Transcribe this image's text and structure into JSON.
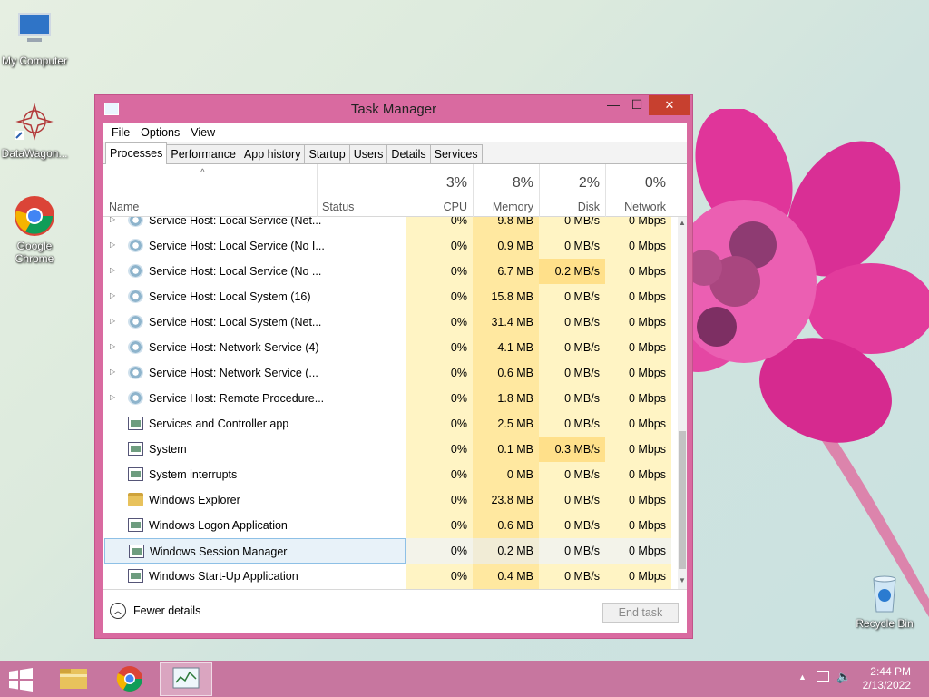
{
  "desktop": {
    "icons": [
      {
        "label": "My Computer",
        "icon": "computer-icon"
      },
      {
        "label": "DataWagon...",
        "icon": "datawagon-icon"
      },
      {
        "label": "Google Chrome",
        "icon": "chrome-icon"
      },
      {
        "label": "Recycle Bin",
        "icon": "recycle-bin-icon"
      }
    ]
  },
  "window": {
    "title": "Task Manager",
    "controls": {
      "minimize": "—",
      "maximize": "☐",
      "close": "✕"
    }
  },
  "menu": [
    "File",
    "Options",
    "View"
  ],
  "tabs": [
    {
      "label": "Processes",
      "active": true
    },
    {
      "label": "Performance"
    },
    {
      "label": "App history"
    },
    {
      "label": "Startup"
    },
    {
      "label": "Users"
    },
    {
      "label": "Details"
    },
    {
      "label": "Services"
    }
  ],
  "columns": {
    "name": "Name",
    "status": "Status",
    "cpu": {
      "pct": "3%",
      "label": "CPU"
    },
    "memory": {
      "pct": "8%",
      "label": "Memory"
    },
    "disk": {
      "pct": "2%",
      "label": "Disk"
    },
    "network": {
      "pct": "0%",
      "label": "Network"
    }
  },
  "rows": [
    {
      "name": "Service Host: Local Service (Net...",
      "icon": "gear-icon",
      "expandable": true,
      "cpu": "0%",
      "memory": "9.8 MB",
      "disk": "0 MB/s",
      "network": "0 Mbps"
    },
    {
      "name": "Service Host: Local Service (No I...",
      "icon": "gear-icon",
      "expandable": true,
      "cpu": "0%",
      "memory": "0.9 MB",
      "disk": "0 MB/s",
      "network": "0 Mbps"
    },
    {
      "name": "Service Host: Local Service (No ...",
      "icon": "gear-icon",
      "expandable": true,
      "cpu": "0%",
      "memory": "6.7 MB",
      "disk": "0.2 MB/s",
      "network": "0 Mbps"
    },
    {
      "name": "Service Host: Local System (16)",
      "icon": "gear-icon",
      "expandable": true,
      "cpu": "0%",
      "memory": "15.8 MB",
      "disk": "0 MB/s",
      "network": "0 Mbps"
    },
    {
      "name": "Service Host: Local System (Net...",
      "icon": "gear-icon",
      "expandable": true,
      "cpu": "0%",
      "memory": "31.4 MB",
      "disk": "0 MB/s",
      "network": "0 Mbps"
    },
    {
      "name": "Service Host: Network Service (4)",
      "icon": "gear-icon",
      "expandable": true,
      "cpu": "0%",
      "memory": "4.1 MB",
      "disk": "0 MB/s",
      "network": "0 Mbps"
    },
    {
      "name": "Service Host: Network Service (...",
      "icon": "gear-icon",
      "expandable": true,
      "cpu": "0%",
      "memory": "0.6 MB",
      "disk": "0 MB/s",
      "network": "0 Mbps"
    },
    {
      "name": "Service Host: Remote Procedure...",
      "icon": "gear-icon",
      "expandable": true,
      "cpu": "0%",
      "memory": "1.8 MB",
      "disk": "0 MB/s",
      "network": "0 Mbps"
    },
    {
      "name": "Services and Controller app",
      "icon": "app-window-icon",
      "expandable": false,
      "cpu": "0%",
      "memory": "2.5 MB",
      "disk": "0 MB/s",
      "network": "0 Mbps"
    },
    {
      "name": "System",
      "icon": "app-window-icon",
      "expandable": false,
      "cpu": "0%",
      "memory": "0.1 MB",
      "disk": "0.3 MB/s",
      "network": "0 Mbps"
    },
    {
      "name": "System interrupts",
      "icon": "app-window-icon",
      "expandable": false,
      "cpu": "0%",
      "memory": "0 MB",
      "disk": "0 MB/s",
      "network": "0 Mbps"
    },
    {
      "name": "Windows Explorer",
      "icon": "folder-icon",
      "expandable": false,
      "cpu": "0%",
      "memory": "23.8 MB",
      "disk": "0 MB/s",
      "network": "0 Mbps"
    },
    {
      "name": "Windows Logon Application",
      "icon": "app-window-icon",
      "expandable": false,
      "cpu": "0%",
      "memory": "0.6 MB",
      "disk": "0 MB/s",
      "network": "0 Mbps"
    },
    {
      "name": "Windows Session Manager",
      "icon": "app-window-icon",
      "expandable": false,
      "selected": true,
      "cpu": "0%",
      "memory": "0.2 MB",
      "disk": "0 MB/s",
      "network": "0 Mbps"
    },
    {
      "name": "Windows Start-Up Application",
      "icon": "app-window-icon",
      "expandable": false,
      "cpu": "0%",
      "memory": "0.4 MB",
      "disk": "0 MB/s",
      "network": "0 Mbps"
    }
  ],
  "footer": {
    "fewer_details": "Fewer details",
    "end_task": "End task"
  },
  "taskbar": {
    "items": [
      "start-icon",
      "file-explorer-icon",
      "chrome-icon",
      "task-manager-icon"
    ],
    "time": "2:44 PM",
    "date": "2/13/2022"
  },
  "colors": {
    "window_frame": "#d96aa0",
    "close_button": "#c7402f",
    "taskbar": "#c7769f",
    "highlight_cell": "#ffe08a",
    "selection": "#e8f2f9"
  }
}
